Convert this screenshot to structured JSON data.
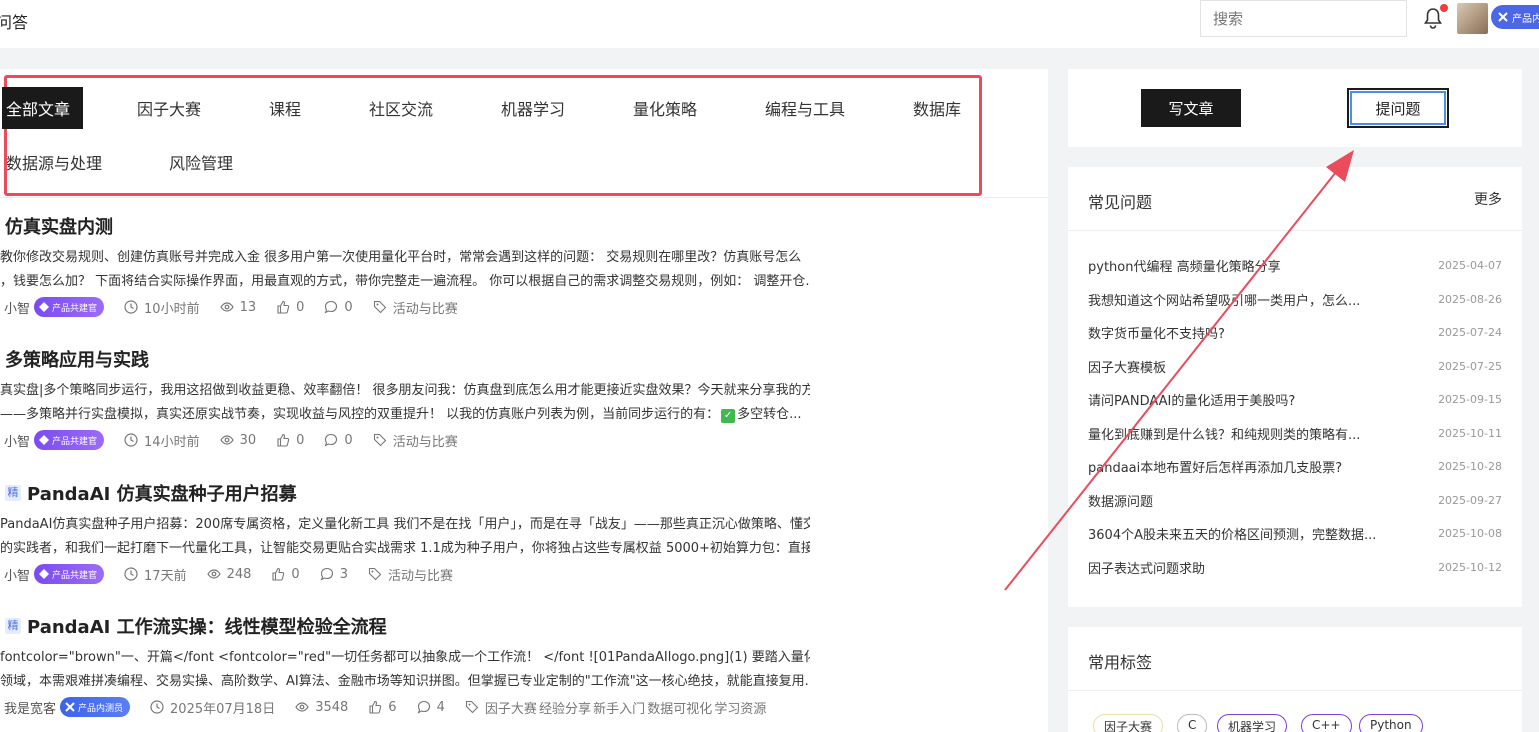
{
  "header": {
    "title": "问答",
    "search_placeholder": "搜索",
    "product_badge": "产品内"
  },
  "categories": [
    {
      "label": "全部文章",
      "active": true
    },
    {
      "label": "因子大赛"
    },
    {
      "label": "课程"
    },
    {
      "label": "社区交流"
    },
    {
      "label": "机器学习"
    },
    {
      "label": "量化策略"
    },
    {
      "label": "编程与工具"
    },
    {
      "label": "数据库"
    },
    {
      "label": "数据源与处理"
    },
    {
      "label": "风险管理"
    }
  ],
  "posts": [
    {
      "title": "仿真实盘内测",
      "featured": false,
      "line1": "教你修改交易规则、创建仿真账号并完成入金 很多用户第一次使用量化平台时，常常会遇到这样的问题： 交易规则在哪里改？仿真账号怎么",
      "line2": "，钱要怎么加？ 下面将结合实际操作界面，用最直观的方式，带你完整走一遍流程。 你可以根据自己的需求调整交易规则，例如： 调整开仓...",
      "author": "小智",
      "badge": "产品共建官",
      "time": "10小时前",
      "views": "13",
      "likes": "0",
      "comments": "0",
      "tags": "活动与比赛"
    },
    {
      "title": "多策略应用与实践",
      "featured": false,
      "line1": "真实盘|多个策略同步运行，我用这招做到收益更稳、效率翻倍！ 很多朋友问我：仿真盘到底怎么用才能更接近实盘效果？今天就来分享我的方",
      "line2": "——多策略并行实盘模拟，真实还原实战节奏，实现收益与风控的双重提升！ 以我的仿真账户列表为例，当前同步运行的有：",
      "line2_tail": "多空转仓...",
      "author": "小智",
      "badge": "产品共建官",
      "time": "14小时前",
      "views": "30",
      "likes": "0",
      "comments": "0",
      "tags": "活动与比赛"
    },
    {
      "title": "PandaAI 仿真实盘种子用户招募",
      "featured": true,
      "featured_label": "精",
      "line1": "PandaAI仿真实盘种子用户招募：200席专属资格，定义量化新工具 我们不是在找「用户」，而是在寻「战友」——那些真正沉心做策略、懂交",
      "line2": "的实践者，和我们一起打磨下一代量化工具，让智能交易更贴合实战需求 1.1成为种子用户，你将独占这些专属权益 5000+初始算力包：直接...",
      "author": "小智",
      "badge": "产品共建官",
      "time": "17天前",
      "views": "248",
      "likes": "0",
      "comments": "3",
      "tags": "活动与比赛"
    },
    {
      "title": "PandaAI 工作流实操：线性模型检验全流程",
      "featured": true,
      "featured_label": "精",
      "line1": "fontcolor=\"brown\"一、开篇</font <fontcolor=\"red\"一切任务都可以抽象成一个工作流！ </font ![01PandaAIlogo.png](1) 要踏入量化投资的复",
      "line2": "领域，本需艰难拼凑编程、交易实操、高阶数学、AI算法、金融市场等知识拼图。但掌握已专业定制的\"工作流\"这一核心绝技，就能直接复用...",
      "author": "我是宽客",
      "badge": "产品内测员",
      "time": "2025年07月18日",
      "views": "3548",
      "likes": "6",
      "comments": "4",
      "tags": "因子大赛  经验分享  新手入门  数据可视化  学习资源"
    }
  ],
  "actions": {
    "write_label": "写文章",
    "ask_label": "提问题"
  },
  "faq": {
    "title": "常见问题",
    "more": "更多",
    "items": [
      {
        "q": "python代编程 高频量化策略分享",
        "d": "2025-04-07"
      },
      {
        "q": "我想知道这个网站希望吸引哪一类用户，怎么...",
        "d": "2025-08-26"
      },
      {
        "q": "数字货币量化不支持吗?",
        "d": "2025-07-24"
      },
      {
        "q": "因子大赛模板",
        "d": "2025-07-25"
      },
      {
        "q": "请问PANDAAI的量化适用于美股吗?",
        "d": "2025-09-15"
      },
      {
        "q": "量化到底赚到是什么钱？和纯规则类的策略有...",
        "d": "2025-10-11"
      },
      {
        "q": "pandaai本地布置好后怎样再添加几支股票?",
        "d": "2025-10-28"
      },
      {
        "q": "数据源问题",
        "d": "2025-09-27"
      },
      {
        "q": "3604个A股未来五天的价格区间预测，完整数据...",
        "d": "2025-10-08"
      },
      {
        "q": "因子表达式问题求助",
        "d": "2025-10-12"
      }
    ]
  },
  "tag_card": {
    "title": "常用标签",
    "tags": [
      "因子大赛",
      "C",
      "机器学习",
      "C++",
      "Python"
    ]
  },
  "colors": {
    "highlight_border": "#ea4c5b",
    "arrow": "#ea4c5b",
    "badge_purple": "#7a4cf0",
    "badge_blue": "#3a64ea"
  }
}
